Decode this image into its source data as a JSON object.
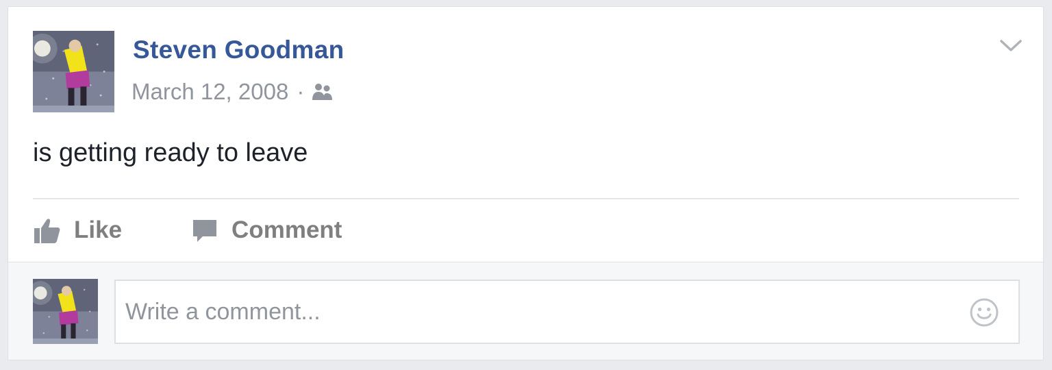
{
  "post": {
    "author": "Steven Goodman",
    "date": "March 12, 2008",
    "separator": "·",
    "audience_icon": "friends-icon",
    "menu_icon": "chevron-down-icon",
    "message": "is getting ready to leave"
  },
  "actions": {
    "like_label": "Like",
    "like_icon": "thumbs-up-icon",
    "comment_label": "Comment",
    "comment_icon": "speech-bubble-icon"
  },
  "comment": {
    "placeholder": "Write a comment...",
    "value": "",
    "emoji_icon": "smiley-icon"
  },
  "colors": {
    "author_link": "#365899",
    "meta_text": "#90949c",
    "message_text": "#1d2129",
    "action_text": "#7f7f7f",
    "page_background": "#e9ebee",
    "comment_area_background": "#f6f7f9"
  }
}
